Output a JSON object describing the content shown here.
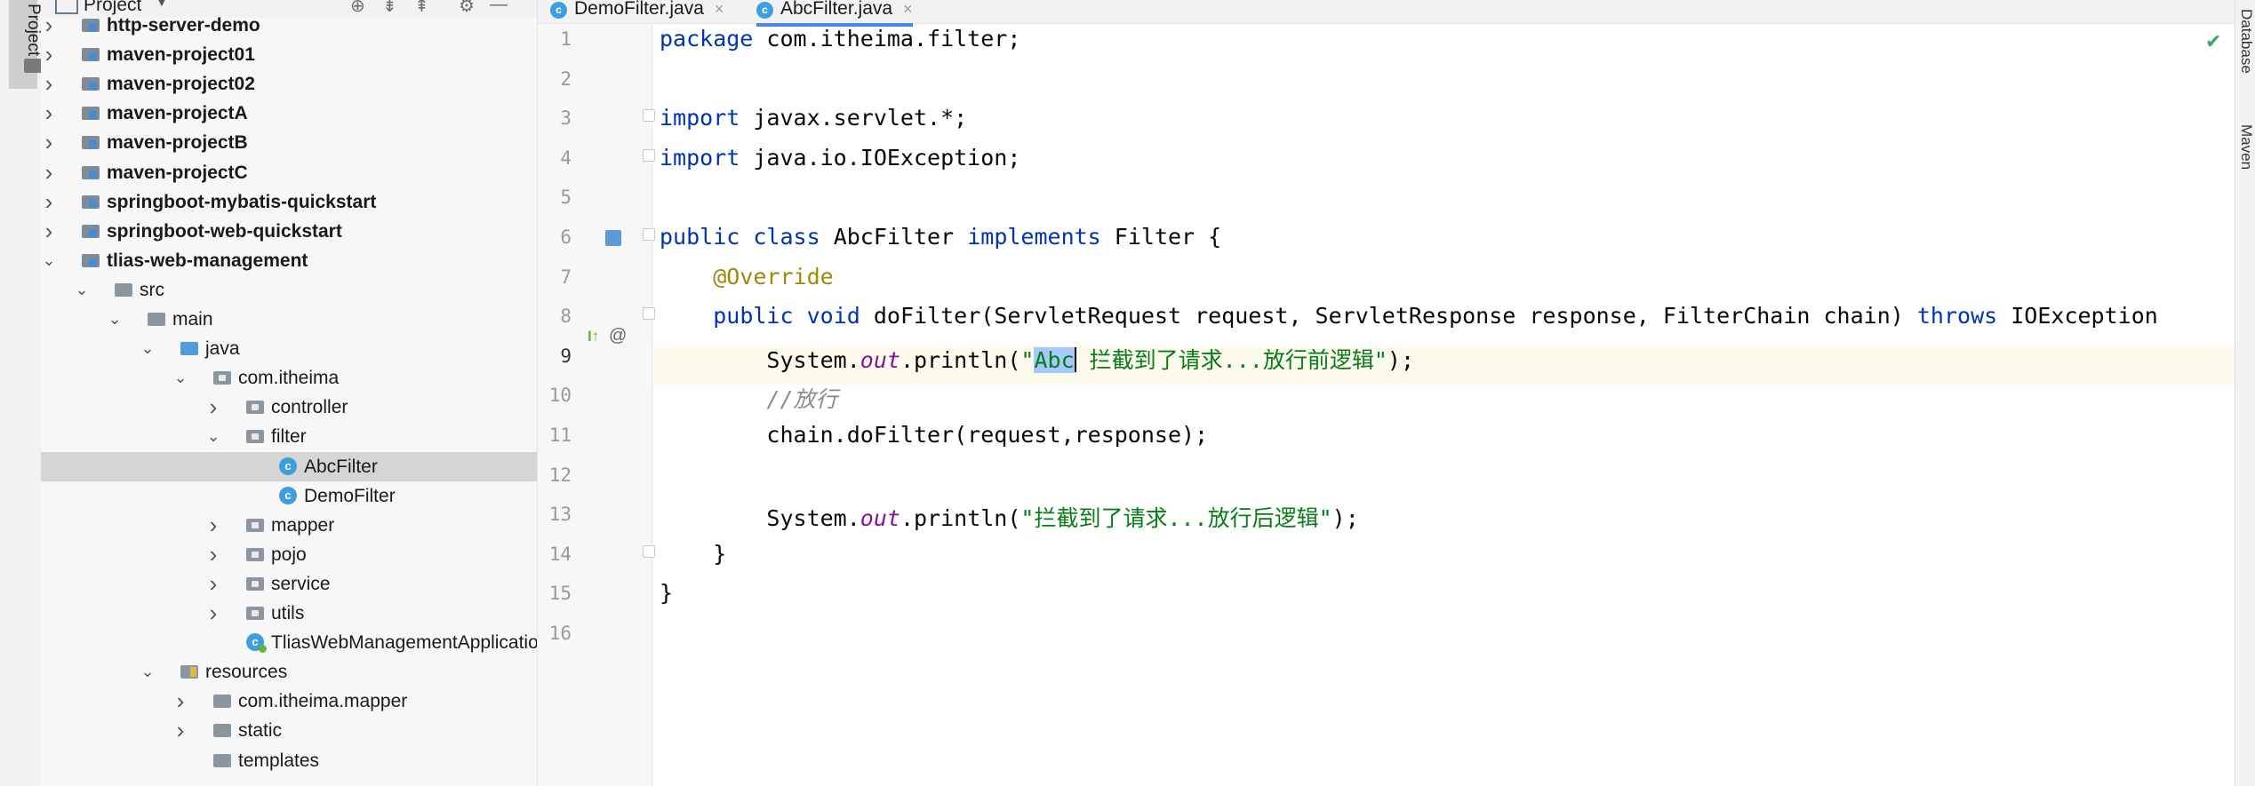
{
  "left_toolstrip": {
    "project_tab_label": "Project"
  },
  "project_panel": {
    "title": "Project",
    "toolbar_icons": [
      "crosshair-icon",
      "expand-all-icon",
      "collapse-all-icon",
      "gear-icon",
      "minimize-icon"
    ],
    "tree": [
      {
        "label": "http-server-demo",
        "type": "module",
        "depth": 0,
        "expanded": false,
        "bold": true
      },
      {
        "label": "maven-project01",
        "type": "module",
        "depth": 0,
        "expanded": false,
        "bold": true
      },
      {
        "label": "maven-project02",
        "type": "module",
        "depth": 0,
        "expanded": false,
        "bold": true
      },
      {
        "label": "maven-projectA",
        "type": "module",
        "depth": 0,
        "expanded": false,
        "bold": true
      },
      {
        "label": "maven-projectB",
        "type": "module",
        "depth": 0,
        "expanded": false,
        "bold": true
      },
      {
        "label": "maven-projectC",
        "type": "module",
        "depth": 0,
        "expanded": false,
        "bold": true
      },
      {
        "label": "springboot-mybatis-quickstart",
        "type": "module",
        "depth": 0,
        "expanded": false,
        "bold": true
      },
      {
        "label": "springboot-web-quickstart",
        "type": "module",
        "depth": 0,
        "expanded": false,
        "bold": true
      },
      {
        "label": "tlias-web-management",
        "type": "module",
        "depth": 0,
        "expanded": true,
        "bold": true
      },
      {
        "label": "src",
        "type": "folder",
        "depth": 1,
        "expanded": true
      },
      {
        "label": "main",
        "type": "folder",
        "depth": 2,
        "expanded": true
      },
      {
        "label": "java",
        "type": "src-folder",
        "depth": 3,
        "expanded": true
      },
      {
        "label": "com.itheima",
        "type": "pkg",
        "depth": 4,
        "expanded": true
      },
      {
        "label": "controller",
        "type": "pkg",
        "depth": 5,
        "expanded": false
      },
      {
        "label": "filter",
        "type": "pkg",
        "depth": 5,
        "expanded": true
      },
      {
        "label": "AbcFilter",
        "type": "class",
        "depth": 6,
        "selected": true
      },
      {
        "label": "DemoFilter",
        "type": "class",
        "depth": 6
      },
      {
        "label": "mapper",
        "type": "pkg",
        "depth": 5,
        "expanded": false
      },
      {
        "label": "pojo",
        "type": "pkg",
        "depth": 5,
        "expanded": false
      },
      {
        "label": "service",
        "type": "pkg",
        "depth": 5,
        "expanded": false
      },
      {
        "label": "utils",
        "type": "pkg",
        "depth": 5,
        "expanded": false
      },
      {
        "label": "TliasWebManagementApplication",
        "type": "spring",
        "depth": 5
      },
      {
        "label": "resources",
        "type": "res-folder",
        "depth": 3,
        "expanded": true
      },
      {
        "label": "com.itheima.mapper",
        "type": "folder",
        "depth": 4,
        "expanded": false
      },
      {
        "label": "static",
        "type": "folder",
        "depth": 4,
        "expanded": false
      },
      {
        "label": "templates",
        "type": "folder",
        "depth": 4
      }
    ]
  },
  "editor": {
    "tabs": [
      {
        "label": "DemoFilter.java",
        "active": false,
        "close": "×"
      },
      {
        "label": "AbcFilter.java",
        "active": true,
        "close": "×"
      }
    ],
    "current_line": 9,
    "lines": [
      {
        "n": "1",
        "text": "package com.itheima.filter;"
      },
      {
        "n": "2",
        "text": ""
      },
      {
        "n": "3",
        "text": "import javax.servlet.*;"
      },
      {
        "n": "4",
        "text": "import java.io.IOException;"
      },
      {
        "n": "5",
        "text": ""
      },
      {
        "n": "6",
        "text": "public class AbcFilter implements Filter {"
      },
      {
        "n": "7",
        "text": "    @Override"
      },
      {
        "n": "8",
        "text": "    public void doFilter(ServletRequest request, ServletResponse response, FilterChain chain) throws IOException"
      },
      {
        "n": "9",
        "text": "        System.out.println(\"Abc 拦截到了请求...放行前逻辑\");"
      },
      {
        "n": "10",
        "text": "        //放行"
      },
      {
        "n": "11",
        "text": "        chain.doFilter(request,response);"
      },
      {
        "n": "12",
        "text": ""
      },
      {
        "n": "13",
        "text": "        System.out.println(\"拦截到了请求...放行后逻辑\");"
      },
      {
        "n": "14",
        "text": "    }"
      },
      {
        "n": "15",
        "text": "}"
      },
      {
        "n": "16",
        "text": ""
      }
    ],
    "inspection_status_icon": "checkmark-icon"
  },
  "right_toolstrip": {
    "tabs": [
      "Database",
      "Maven"
    ]
  },
  "colors": {
    "keyword": "#0033b3",
    "annotation": "#9e880d",
    "string": "#067d17",
    "static_field": "#871094",
    "comment": "#8c8c8c",
    "selection": "#a6c8ff",
    "tree_selected": "#d5d5d5",
    "class_icon": "#3f9fdc"
  }
}
